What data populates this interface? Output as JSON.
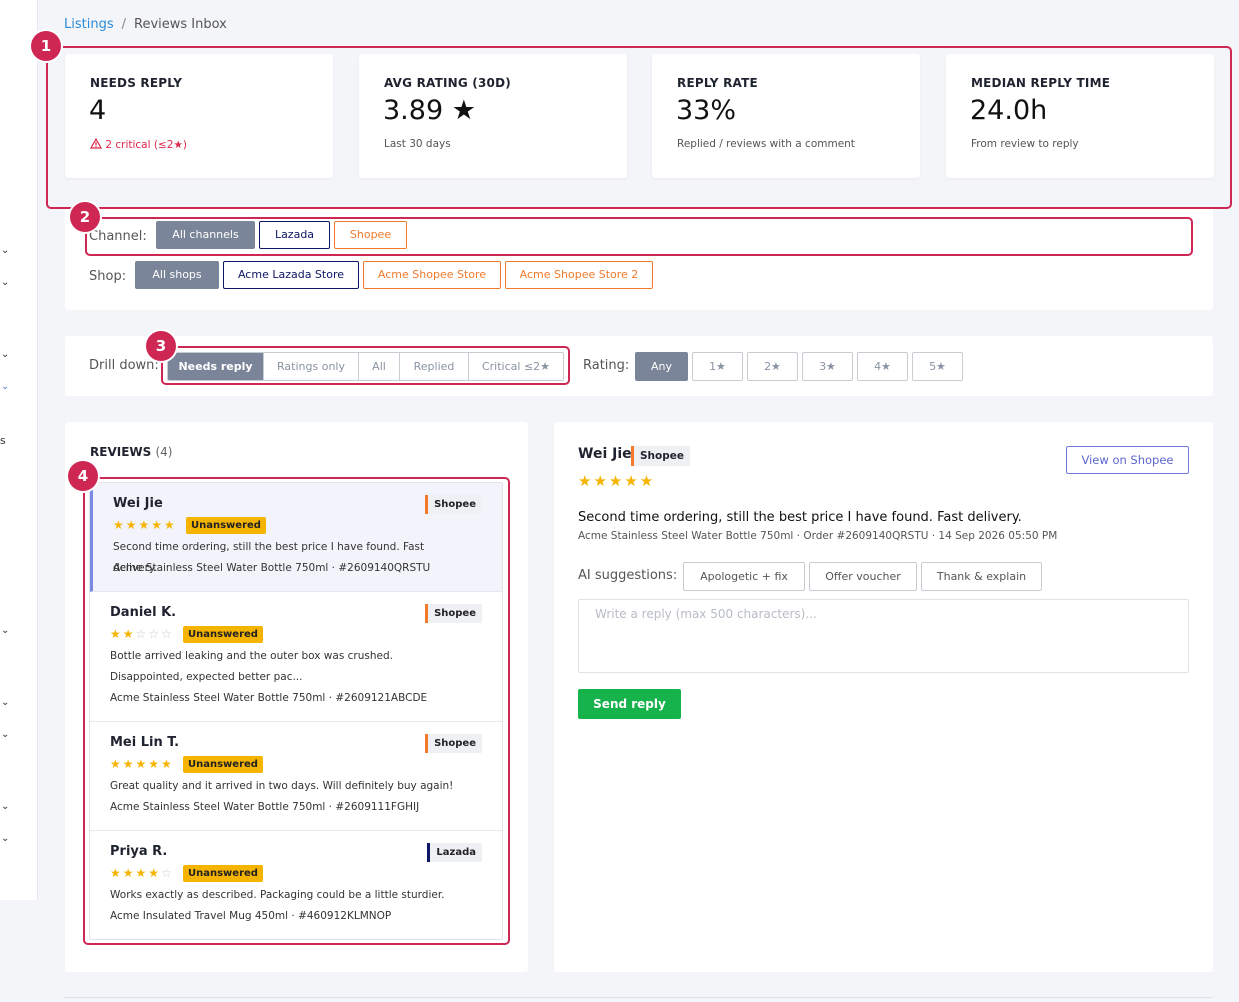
{
  "breadcrumb": {
    "parent": "Listings",
    "separator": "/",
    "current": "Reviews Inbox"
  },
  "kpis": [
    {
      "label": "NEEDS REPLY",
      "value": "4",
      "sub": "2 critical (≤2★)",
      "sub_icon": "warning-triangle-icon",
      "sub_color": "#e0264a"
    },
    {
      "label": "AVG RATING (30D)",
      "value": "3.89 ★",
      "sub": "Last 30 days"
    },
    {
      "label": "REPLY RATE",
      "value": "33%",
      "sub": "Replied / reviews with a comment"
    },
    {
      "label": "MEDIAN REPLY TIME",
      "value": "24.0h",
      "sub": "From review to reply"
    }
  ],
  "filters": {
    "channel_label": "Channel:",
    "channels": [
      "All channels",
      "Lazada",
      "Shopee"
    ],
    "channel_selected": "All channels",
    "shop_label": "Shop:",
    "shops": [
      "All shops",
      "Acme Lazada Store",
      "Acme Shopee Store",
      "Acme Shopee Store 2"
    ],
    "shop_selected": "All shops"
  },
  "drilldown": {
    "label": "Drill down:",
    "options": [
      "Needs reply",
      "Ratings only",
      "All",
      "Replied",
      "Critical ≤2★"
    ],
    "selected": "Needs reply",
    "rating_label": "Rating:",
    "ratings": [
      "Any",
      "1★",
      "2★",
      "3★",
      "4★",
      "5★"
    ],
    "rating_selected": "Any"
  },
  "reviews": {
    "title": "REVIEWS",
    "count": "(4)",
    "items": [
      {
        "name": "Wei Jie",
        "rating": 5,
        "status": "Unanswered",
        "channel": "Shopee",
        "text": "Second time ordering, still the best price I have found. Fast delivery.",
        "product": "Acme Stainless Steel Water Bottle 750ml · #2609140QRSTU"
      },
      {
        "name": "Daniel K.",
        "rating": 2,
        "status": "Unanswered",
        "channel": "Shopee",
        "text": "Bottle arrived leaking and the outer box was crushed. Disappointed, expected better pac...",
        "product": "Acme Stainless Steel Water Bottle 750ml · #2609121ABCDE"
      },
      {
        "name": "Mei Lin T.",
        "rating": 5,
        "status": "Unanswered",
        "channel": "Shopee",
        "text": "Great quality and it arrived in two days. Will definitely buy again!",
        "product": "Acme Stainless Steel Water Bottle 750ml · #2609111FGHIJ"
      },
      {
        "name": "Priya R.",
        "rating": 4,
        "status": "Unanswered",
        "channel": "Lazada",
        "text": "Works exactly as described. Packaging could be a little sturdier.",
        "product": "Acme Insulated Travel Mug 450ml · #460912KLMNOP"
      }
    ]
  },
  "detail": {
    "name": "Wei Jie",
    "channel": "Shopee",
    "rating": 5,
    "view_button": "View on Shopee",
    "text": "Second time ordering, still the best price I have found. Fast delivery.",
    "meta": "Acme Stainless Steel Water Bottle 750ml · Order #2609140QRSTU · 14 Sep 2026 05:50 PM",
    "ai_label": "AI suggestions:",
    "ai_suggestions": [
      "Apologetic + fix",
      "Offer voucher",
      "Thank & explain"
    ],
    "reply_placeholder": "Write a reply (max 500 characters)...",
    "send_button": "Send reply"
  },
  "annotations": [
    "1",
    "2",
    "3",
    "4"
  ],
  "sidebar": {
    "fragment": "s"
  },
  "colors": {
    "accent_red": "#cf2754",
    "shopee": "#f27a2a",
    "lazada": "#0d1566",
    "star": "#f5b400",
    "send": "#16b24b",
    "active_chip": "#7b8599"
  }
}
